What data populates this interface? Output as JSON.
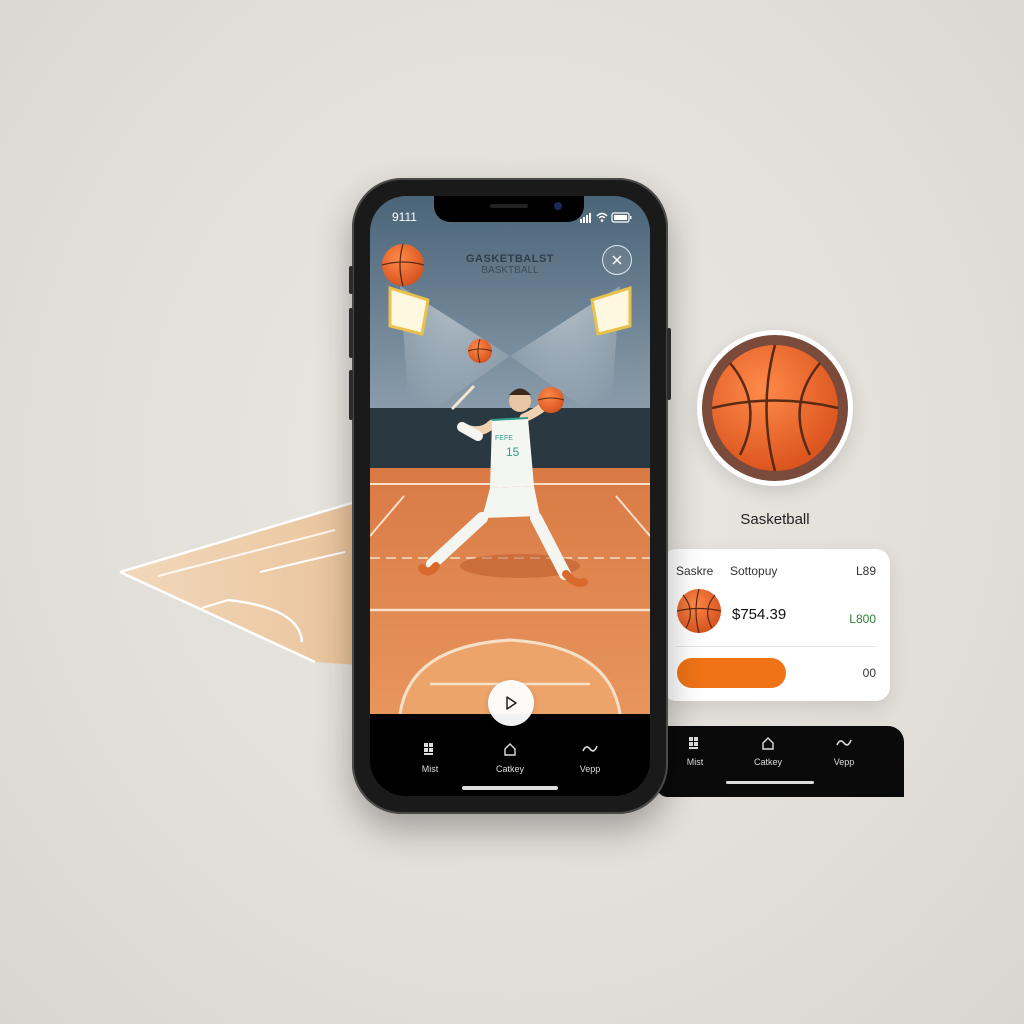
{
  "status_bar": {
    "time": "9111"
  },
  "scene": {
    "title_line1": "GASKETBALST",
    "title_line2": "BASKTBALL",
    "jersey_number": "15",
    "jersey_text": "FEFE"
  },
  "tab_bar": {
    "items": [
      {
        "label": "Mist",
        "icon": "grid-icon"
      },
      {
        "label": "Catkey",
        "icon": "home-icon"
      },
      {
        "label": "Vepp",
        "icon": "wave-icon"
      }
    ]
  },
  "badge": {
    "label": "Sasketball"
  },
  "product_card": {
    "header_col1": "Saskre",
    "header_col2": "Sottopuy",
    "header_col3": "L89",
    "price": "$754.39",
    "badge_text": "L800",
    "quantity": "00"
  },
  "secondary_nav": {
    "items": [
      {
        "label": "Mist",
        "icon": "grid-icon"
      },
      {
        "label": "Catkey",
        "icon": "home-icon"
      },
      {
        "label": "Vepp",
        "icon": "wave-icon"
      }
    ]
  },
  "colors": {
    "accent_orange": "#f07316",
    "court": "#e08a50",
    "badge_green": "#2e7d32",
    "ball": "#e0602a"
  }
}
